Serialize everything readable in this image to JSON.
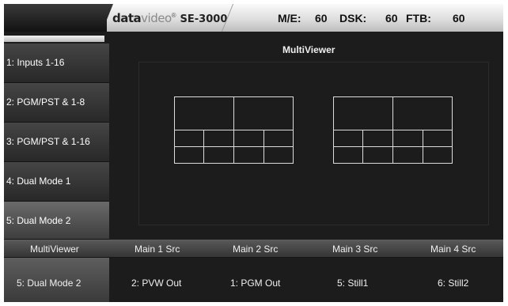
{
  "header": {
    "brand_data": "data",
    "brand_video": "video",
    "brand_mark": "®",
    "model": "SE-3000",
    "me_label": "M/E:",
    "me_value": "60",
    "dsk_label": "DSK:",
    "dsk_value": "60",
    "ftb_label": "FTB:",
    "ftb_value": "60"
  },
  "sidebar": {
    "items": [
      {
        "label": "1: Inputs 1-16"
      },
      {
        "label": "2: PGM/PST & 1-8"
      },
      {
        "label": "3: PGM/PST & 1-16"
      },
      {
        "label": "4: Dual Mode 1"
      },
      {
        "label": "5: Dual Mode 2",
        "selected": true
      }
    ]
  },
  "main": {
    "title": "MultiViewer"
  },
  "bottom": {
    "headers": [
      "MultiViewer",
      "Main 1 Src",
      "Main 2 Src",
      "Main 3 Src",
      "Main 4 Src"
    ],
    "values": [
      "5: Dual Mode 2",
      "2: PVW Out",
      "1: PGM Out",
      "5: Still1",
      "6: Still2"
    ]
  },
  "colors": {
    "background": "#1c1c1c",
    "header_light": "#e4e4e4",
    "grid_lines": "#dcdcdc",
    "text": "#f0f0f0"
  }
}
